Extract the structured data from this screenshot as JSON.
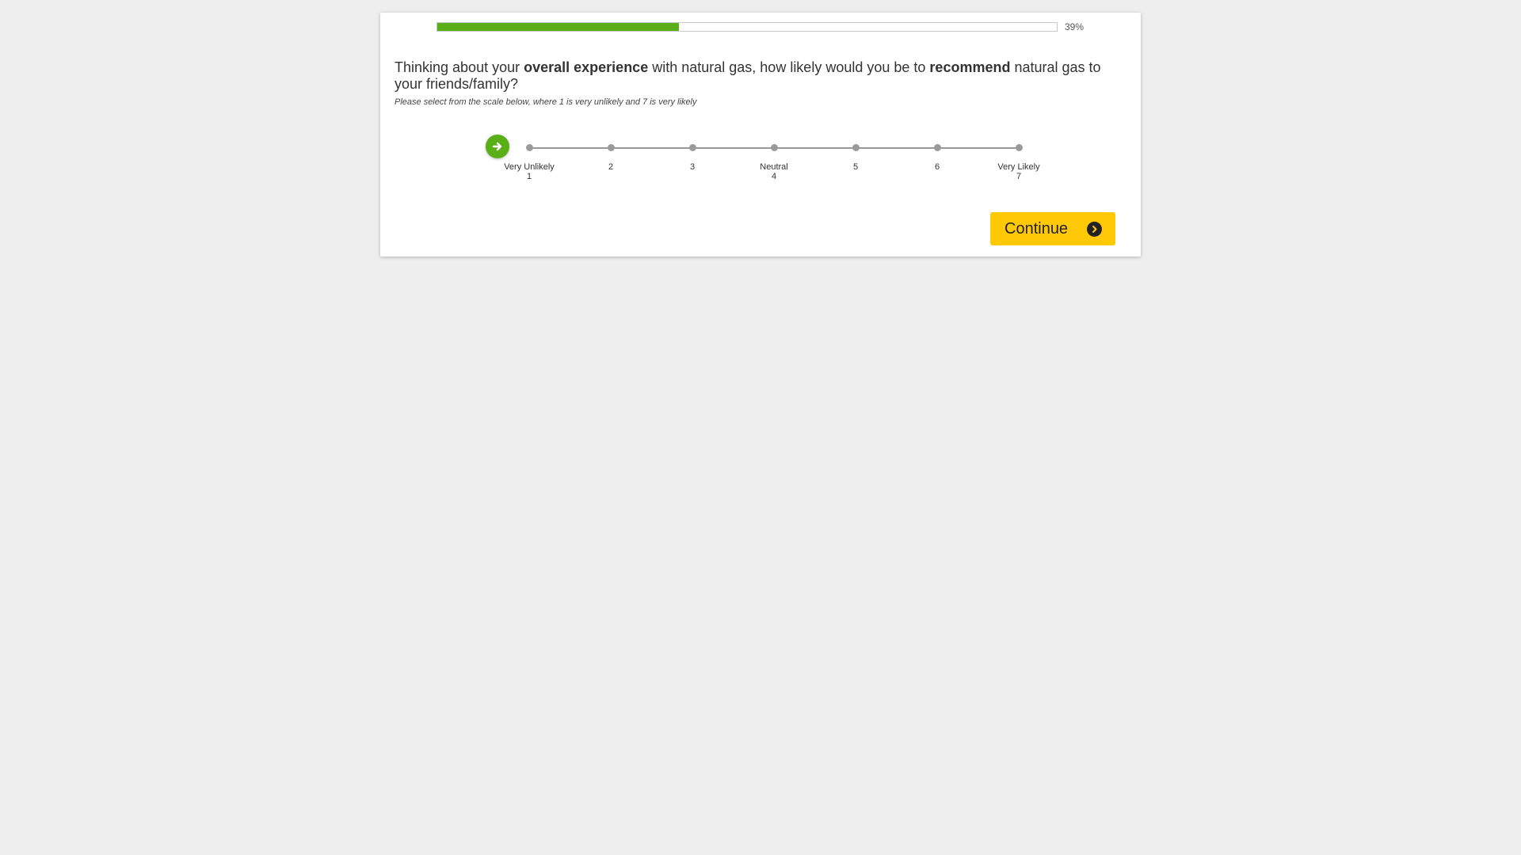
{
  "progress": {
    "percent": 39,
    "label": "39%"
  },
  "question": {
    "part1": "Thinking about your ",
    "bold1": "overall experience",
    "part2": " with natural gas, how likely would you be to ",
    "bold2": "recommend",
    "part3": " natural gas to your friends/family?"
  },
  "instruction": "Please select from the scale below, where 1 is very unlikely and 7 is very likely",
  "scale": {
    "points": [
      {
        "value": "1",
        "label": "Very Unlikely"
      },
      {
        "value": "2",
        "label": ""
      },
      {
        "value": "3",
        "label": ""
      },
      {
        "value": "4",
        "label": "Neutral"
      },
      {
        "value": "5",
        "label": ""
      },
      {
        "value": "6",
        "label": ""
      },
      {
        "value": "7",
        "label": "Very Likely"
      }
    ],
    "handle_icon": "arrow-right-icon",
    "handle_color": "#5aaf17"
  },
  "continue_button": {
    "label": "Continue",
    "icon": "chevron-right-circle-icon",
    "color": "#ffc907"
  },
  "colors": {
    "progress_fill": "#5aaf17",
    "background": "#eeeeee"
  }
}
